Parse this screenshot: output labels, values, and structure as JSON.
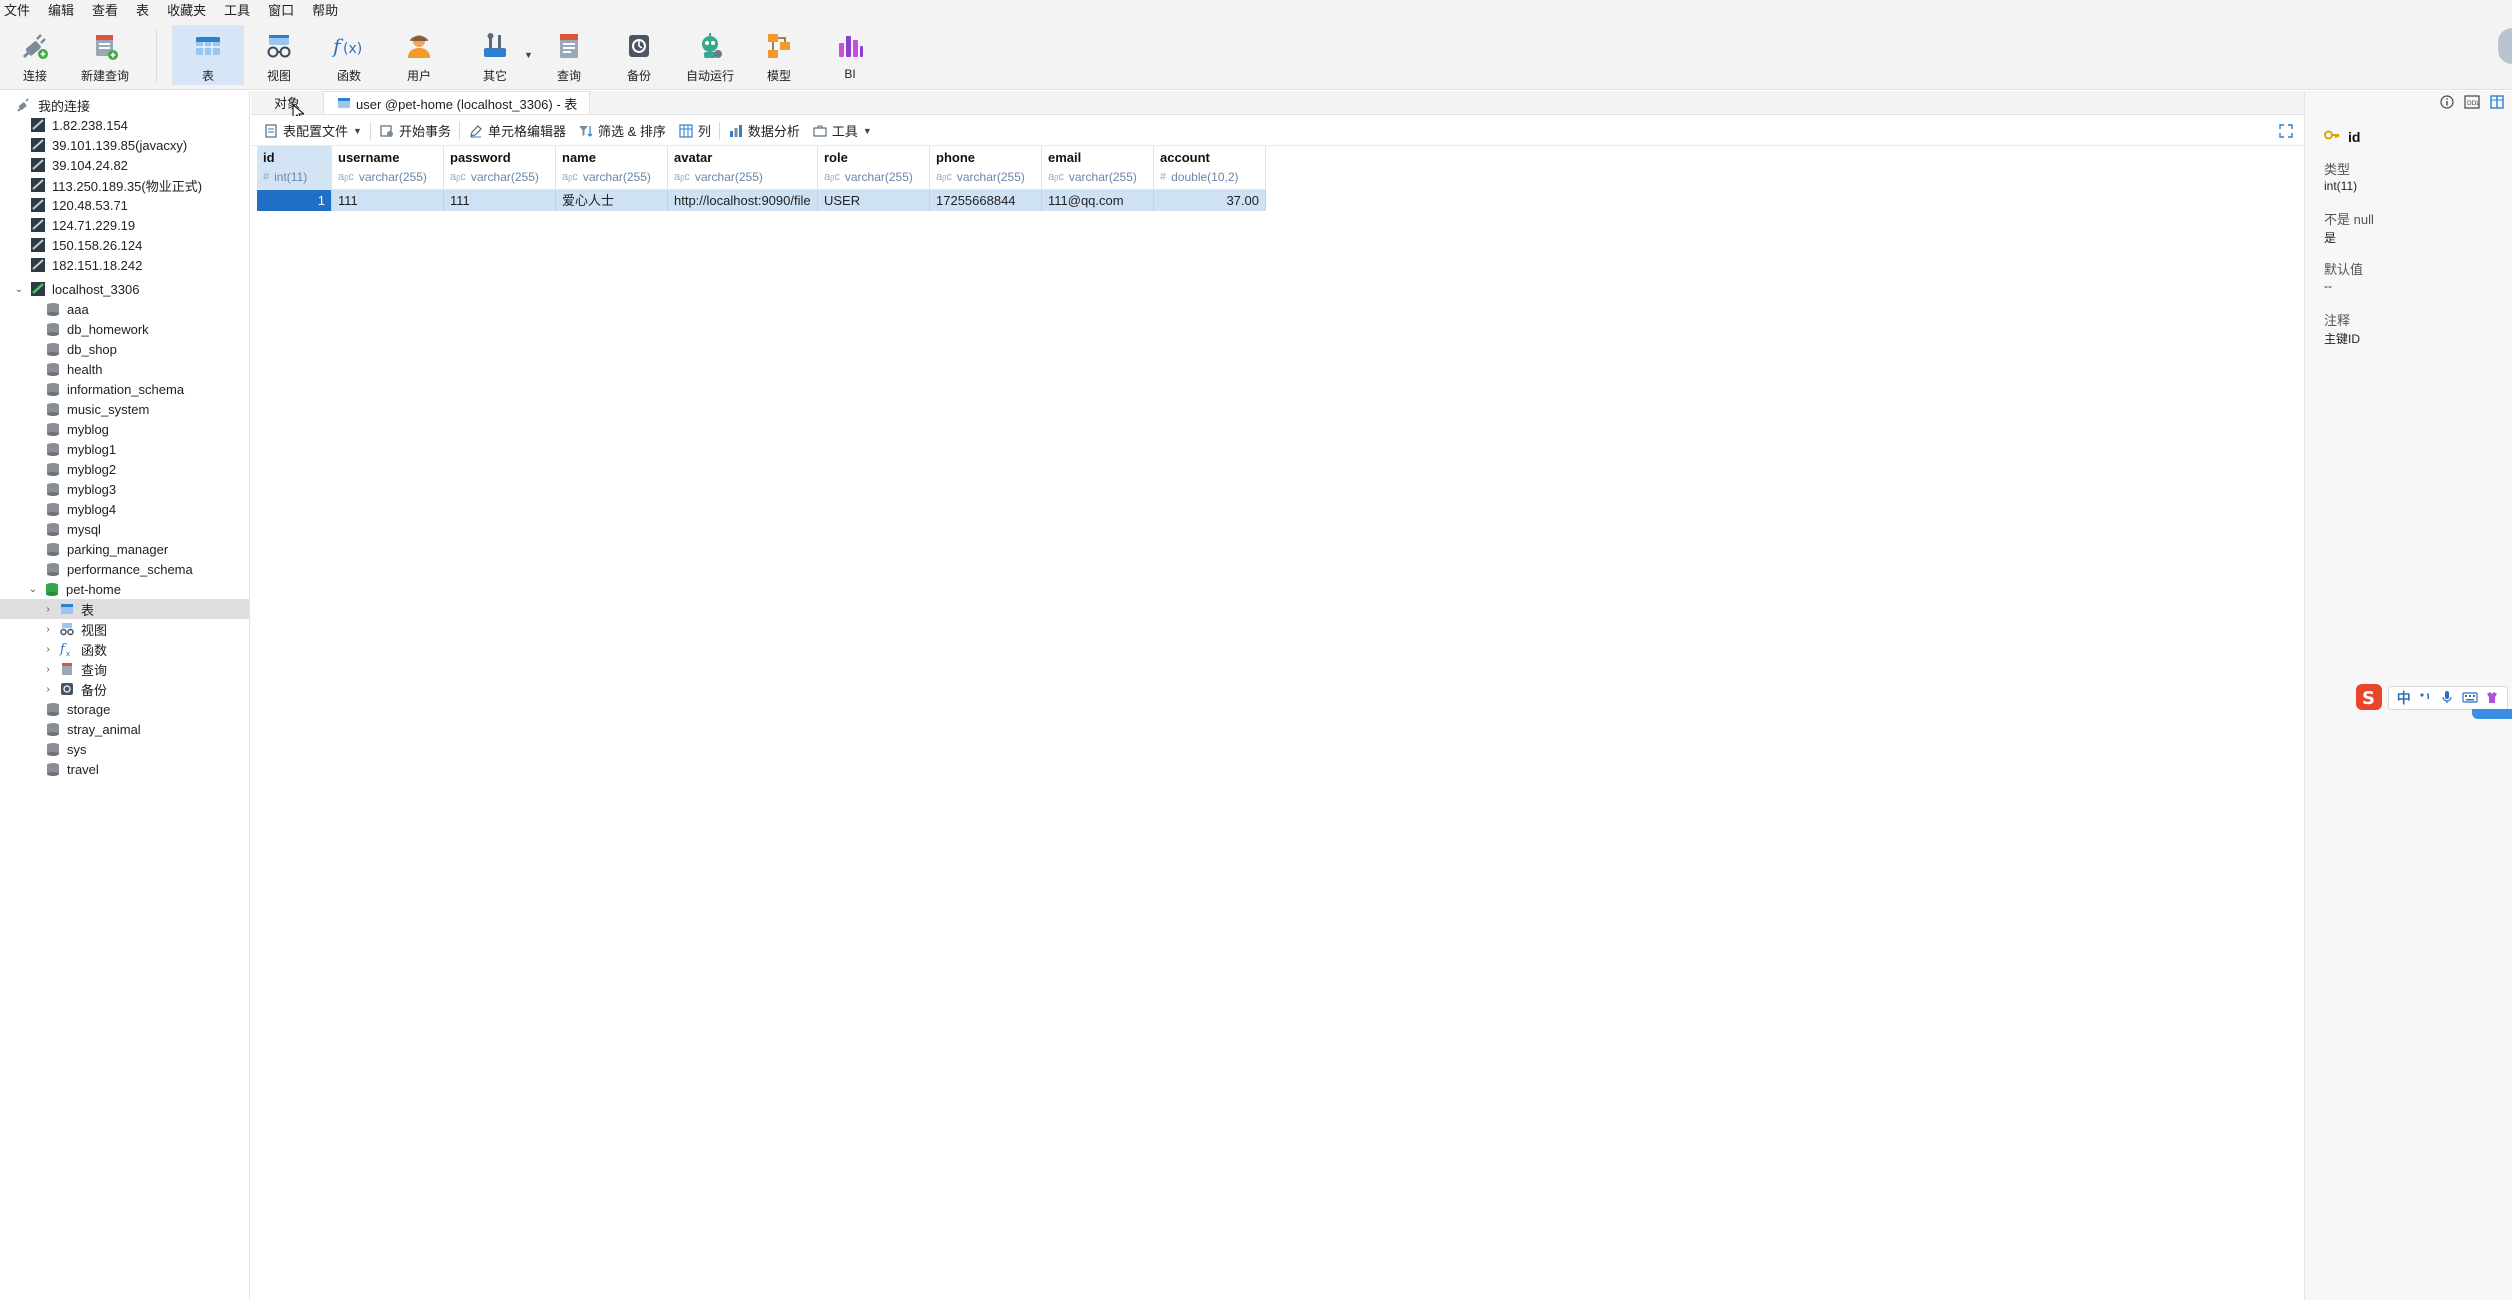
{
  "menu": [
    "文件",
    "编辑",
    "查看",
    "表",
    "收藏夹",
    "工具",
    "窗口",
    "帮助"
  ],
  "ribbon": {
    "connect": "连接",
    "new_query": "新建查询",
    "table": "表",
    "view": "视图",
    "function": "函数",
    "user": "用户",
    "other": "其它",
    "query": "查询",
    "backup": "备份",
    "auto_run": "自动运行",
    "model": "模型",
    "bi": "BI"
  },
  "sidebar": {
    "root": "我的连接",
    "connections": [
      "1.82.238.154",
      "39.101.139.85(javacxy)",
      "39.104.24.82",
      "113.250.189.35(物业正式)",
      "120.48.53.71",
      "124.71.229.19",
      "150.158.26.124",
      "182.151.18.242"
    ],
    "localhost": "localhost_3306",
    "databases_before": [
      "aaa",
      "db_homework",
      "db_shop",
      "health",
      "information_schema",
      "music_system",
      "myblog",
      "myblog1",
      "myblog2",
      "myblog3",
      "myblog4",
      "mysql",
      "parking_manager",
      "performance_schema"
    ],
    "open_db": "pet-home",
    "open_db_children": [
      "表",
      "视图",
      "函数",
      "查询",
      "备份"
    ],
    "databases_after": [
      "storage",
      "stray_animal",
      "sys",
      "travel"
    ]
  },
  "tabs": {
    "objects": "对象",
    "active": "user @pet-home (localhost_3306) - 表"
  },
  "subtoolbar": {
    "table_profile": "表配置文件",
    "begin_tx": "开始事务",
    "cell_editor": "单元格编辑器",
    "filter_sort": "筛选 & 排序",
    "columns": "列",
    "data_analysis": "数据分析",
    "tools": "工具"
  },
  "grid": {
    "columns": [
      {
        "name": "id",
        "type": "int(11)",
        "sym": "#"
      },
      {
        "name": "username",
        "type": "varchar(255)",
        "sym": "aᵦc"
      },
      {
        "name": "password",
        "type": "varchar(255)",
        "sym": "aᵦc"
      },
      {
        "name": "name",
        "type": "varchar(255)",
        "sym": "aᵦc"
      },
      {
        "name": "avatar",
        "type": "varchar(255)",
        "sym": "aᵦc"
      },
      {
        "name": "role",
        "type": "varchar(255)",
        "sym": "aᵦc"
      },
      {
        "name": "phone",
        "type": "varchar(255)",
        "sym": "aᵦc"
      },
      {
        "name": "email",
        "type": "varchar(255)",
        "sym": "aᵦc"
      },
      {
        "name": "account",
        "type": "double(10,2)",
        "sym": "#"
      }
    ],
    "rows": [
      [
        "1",
        "111",
        "111",
        "爱心人士",
        "http://localhost:9090/file",
        "USER",
        "17255668844",
        "111@qq.com",
        "37.00"
      ]
    ]
  },
  "rightpanel": {
    "field": "id",
    "type_label": "类型",
    "type_value": "int(11)",
    "notnull_label": "不是 null",
    "notnull_value": "是",
    "default_label": "默认值",
    "default_value": "--",
    "comment_label": "注释",
    "comment_value": "主键ID"
  },
  "ime": {
    "lang": "中"
  }
}
